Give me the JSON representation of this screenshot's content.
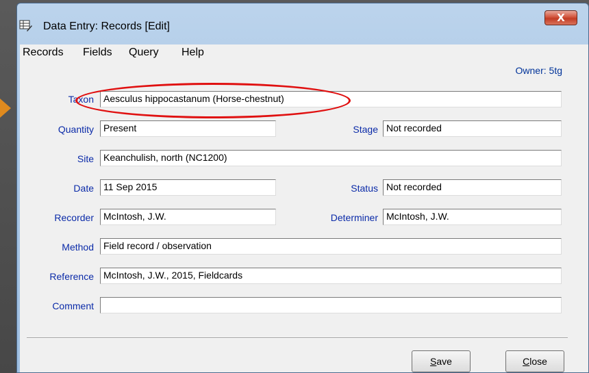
{
  "window": {
    "title": "Data Entry: Records [Edit]",
    "close_label": "X"
  },
  "menu": [
    "Records",
    "Fields",
    "Query",
    "Help"
  ],
  "owner": "Owner: 5tg",
  "fields": {
    "taxon": {
      "label": "Taxon",
      "value": "Aesculus hippocastanum (Horse-chestnut)"
    },
    "quantity": {
      "label": "Quantity",
      "value": "Present"
    },
    "stage": {
      "label": "Stage",
      "value": "Not recorded"
    },
    "site": {
      "label": "Site",
      "value": "Keanchulish, north  (NC1200)"
    },
    "date": {
      "label": "Date",
      "value": "11 Sep 2015"
    },
    "status": {
      "label": "Status",
      "value": "Not recorded"
    },
    "recorder": {
      "label": "Recorder",
      "value": "McIntosh, J.W."
    },
    "determiner": {
      "label": "Determiner",
      "value": "McIntosh, J.W."
    },
    "method": {
      "label": "Method",
      "value": "Field record / observation"
    },
    "reference": {
      "label": "Reference",
      "value": "McIntosh, J.W., 2015, Fieldcards"
    },
    "comment": {
      "label": "Comment",
      "value": ""
    }
  },
  "buttons": {
    "save": {
      "ul": "S",
      "rest": "ave"
    },
    "close": {
      "ul": "C",
      "rest": "lose"
    }
  },
  "colors": {
    "label_blue": "#0a2aa8",
    "highlight_red": "#e01010",
    "pointer_orange": "#e08a1e"
  }
}
